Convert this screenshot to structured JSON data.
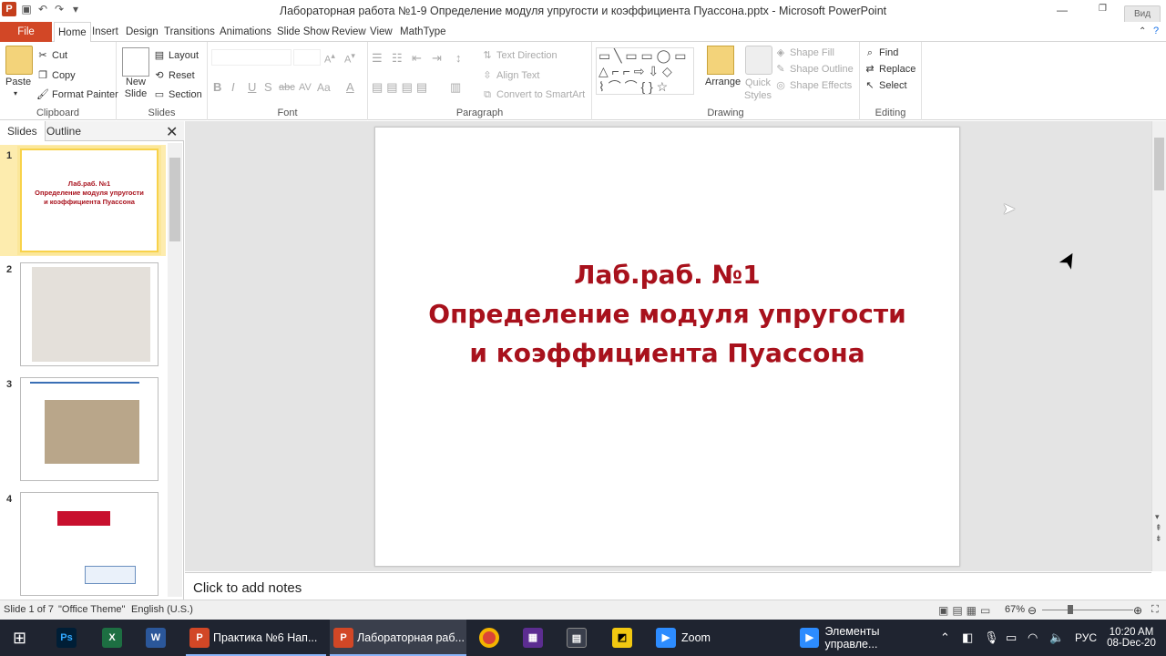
{
  "window": {
    "title": "Лабораторная работа №1-9 Определение модуля упругости и коэффициента Пуассона.pptx - Microsoft PowerPoint",
    "view_button": "Вид",
    "app_logo": "P"
  },
  "tabs": [
    "File",
    "Home",
    "Insert",
    "Design",
    "Transitions",
    "Animations",
    "Slide Show",
    "Review",
    "View",
    "MathType"
  ],
  "ribbon": {
    "clipboard": {
      "label": "Clipboard",
      "paste": "Paste",
      "cut": "Cut",
      "copy": "Copy",
      "format_painter": "Format Painter"
    },
    "slides": {
      "label": "Slides",
      "new_slide": "New Slide",
      "layout": "Layout",
      "reset": "Reset",
      "section": "Section"
    },
    "font": {
      "label": "Font",
      "bold": "B",
      "italic": "I",
      "underline": "U",
      "shadow": "S",
      "strike": "abc",
      "spacing": "AV",
      "case": "Aa",
      "color": "A"
    },
    "paragraph": {
      "label": "Paragraph",
      "text_direction": "Text Direction",
      "align_text": "Align Text",
      "convert_smartart": "Convert to SmartArt"
    },
    "drawing": {
      "label": "Drawing",
      "arrange": "Arrange",
      "quick_styles": "Quick Styles",
      "shape_fill": "Shape Fill",
      "shape_outline": "Shape Outline",
      "shape_effects": "Shape Effects"
    },
    "editing": {
      "label": "Editing",
      "find": "Find",
      "replace": "Replace",
      "select": "Select"
    }
  },
  "left_pane": {
    "tab_slides": "Slides",
    "tab_outline": "Outline",
    "thumbs": [
      {
        "num": "1",
        "line1": "Лаб.раб. №1",
        "line2": "Определение модуля упругости",
        "line3": "и коэффициента Пуассона"
      },
      {
        "num": "2"
      },
      {
        "num": "3"
      },
      {
        "num": "4"
      }
    ]
  },
  "slide": {
    "line1": "Лаб.раб. №1",
    "line2": "Определение модуля упругости",
    "line3": "и коэффициента Пуассона"
  },
  "notes_placeholder": "Click to add notes",
  "status": {
    "slide_of": "Slide 1 of 7",
    "theme": "\"Office Theme\"",
    "language": "English (U.S.)",
    "zoom": "67%"
  },
  "taskbar": {
    "items": [
      {
        "label": "Практика №6 Нап..."
      },
      {
        "label": "Лабораторная раб..."
      },
      {
        "label": "Zoom"
      },
      {
        "label": "Элементы управле..."
      }
    ],
    "lang": "РУС",
    "time": "10:20 AM",
    "date": "08-Dec-20"
  },
  "colors": {
    "accent": "#d24726",
    "slide_text": "#a8111c",
    "taskbar": "#1f2430"
  }
}
